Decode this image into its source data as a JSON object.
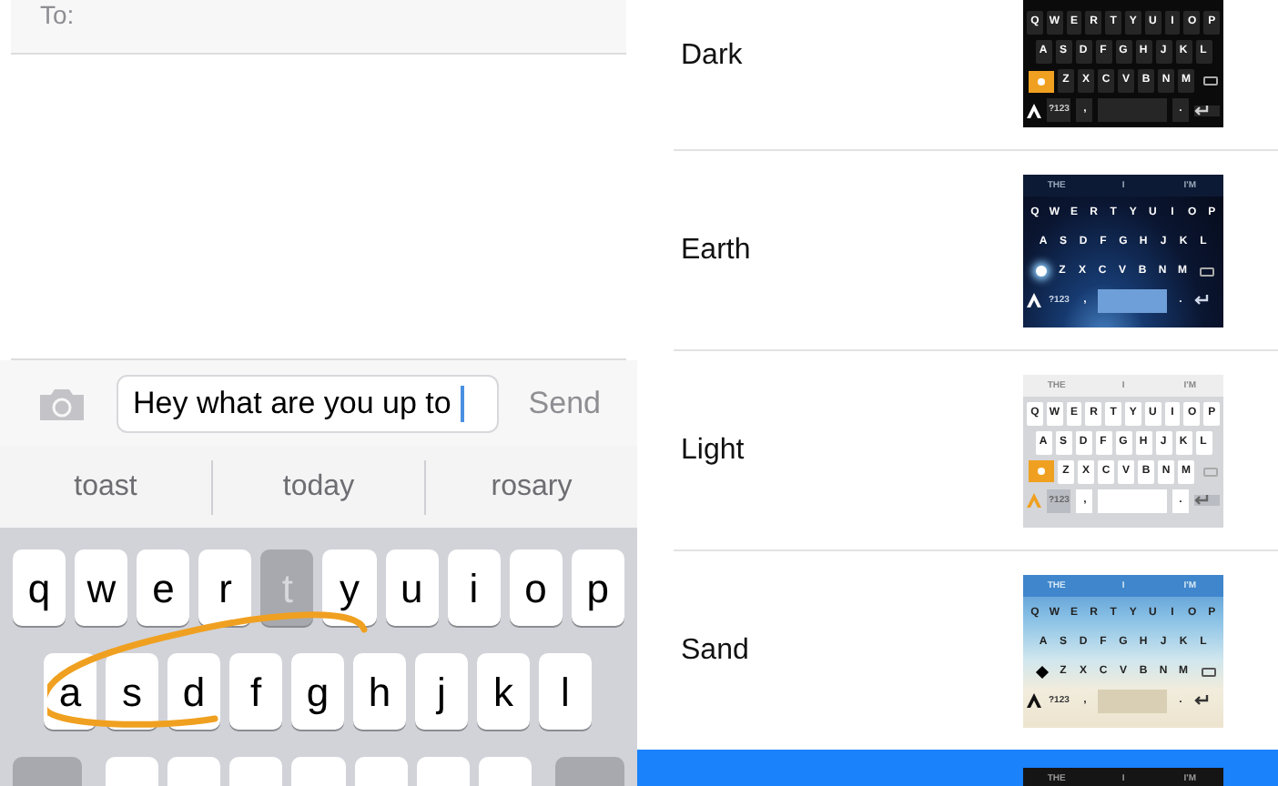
{
  "compose": {
    "to_label": "To:",
    "message": "Hey what are you up to",
    "send": "Send",
    "suggestions": [
      "toast",
      "today",
      "rosary"
    ],
    "keyboard": {
      "rows": [
        [
          {
            "label": "q",
            "pressed": false
          },
          {
            "label": "w",
            "pressed": false
          },
          {
            "label": "e",
            "pressed": false
          },
          {
            "label": "r",
            "pressed": false
          },
          {
            "label": "t",
            "pressed": true
          },
          {
            "label": "y",
            "pressed": false
          },
          {
            "label": "u",
            "pressed": false
          },
          {
            "label": "i",
            "pressed": false
          },
          {
            "label": "o",
            "pressed": false
          },
          {
            "label": "p",
            "pressed": false
          }
        ],
        [
          {
            "label": "a",
            "pressed": false
          },
          {
            "label": "s",
            "pressed": false
          },
          {
            "label": "d",
            "pressed": false
          },
          {
            "label": "f",
            "pressed": false
          },
          {
            "label": "g",
            "pressed": false
          },
          {
            "label": "h",
            "pressed": false
          },
          {
            "label": "j",
            "pressed": false
          },
          {
            "label": "k",
            "pressed": false
          },
          {
            "label": "l",
            "pressed": false
          }
        ]
      ]
    }
  },
  "themes": [
    {
      "name": "Dark",
      "kind": "dark",
      "selected": false,
      "thumbnail": {
        "rows": [
          [
            "Q",
            "W",
            "E",
            "R",
            "T",
            "Y",
            "U",
            "I",
            "O",
            "P"
          ],
          [
            "A",
            "S",
            "D",
            "F",
            "G",
            "H",
            "J",
            "K",
            "L"
          ],
          [
            "Z",
            "X",
            "C",
            "V",
            "B",
            "N",
            "M"
          ]
        ],
        "bottom": [
          "?123",
          ",",
          "."
        ]
      }
    },
    {
      "name": "Earth",
      "kind": "earth",
      "selected": false,
      "thumbnail": {
        "suggestions": [
          "THE",
          "I",
          "I'M"
        ],
        "rows": [
          [
            "Q",
            "W",
            "E",
            "R",
            "T",
            "Y",
            "U",
            "I",
            "O",
            "P"
          ],
          [
            "A",
            "S",
            "D",
            "F",
            "G",
            "H",
            "J",
            "K",
            "L"
          ],
          [
            "Z",
            "X",
            "C",
            "V",
            "B",
            "N",
            "M"
          ]
        ],
        "bottom": [
          "?123",
          ",",
          "."
        ]
      }
    },
    {
      "name": "Light",
      "kind": "light",
      "selected": false,
      "thumbnail": {
        "suggestions": [
          "THE",
          "I",
          "I'M"
        ],
        "rows": [
          [
            "Q",
            "W",
            "E",
            "R",
            "T",
            "Y",
            "U",
            "I",
            "O",
            "P"
          ],
          [
            "A",
            "S",
            "D",
            "F",
            "G",
            "H",
            "J",
            "K",
            "L"
          ],
          [
            "Z",
            "X",
            "C",
            "V",
            "B",
            "N",
            "M"
          ]
        ],
        "bottom": [
          "?123",
          ",",
          "."
        ]
      }
    },
    {
      "name": "Sand",
      "kind": "sand",
      "selected": false,
      "thumbnail": {
        "suggestions": [
          "THE",
          "I",
          "I'M"
        ],
        "rows": [
          [
            "Q",
            "W",
            "E",
            "R",
            "T",
            "Y",
            "U",
            "I",
            "O",
            "P"
          ],
          [
            "A",
            "S",
            "D",
            "F",
            "G",
            "H",
            "J",
            "K",
            "L"
          ],
          [
            "Z",
            "X",
            "C",
            "V",
            "B",
            "N",
            "M"
          ]
        ],
        "bottom": [
          "?123",
          ",",
          "."
        ]
      }
    },
    {
      "kind": "dark",
      "selected": true,
      "thumbnail": {
        "suggestions": [
          "THE",
          "I",
          "I'M"
        ]
      }
    }
  ]
}
